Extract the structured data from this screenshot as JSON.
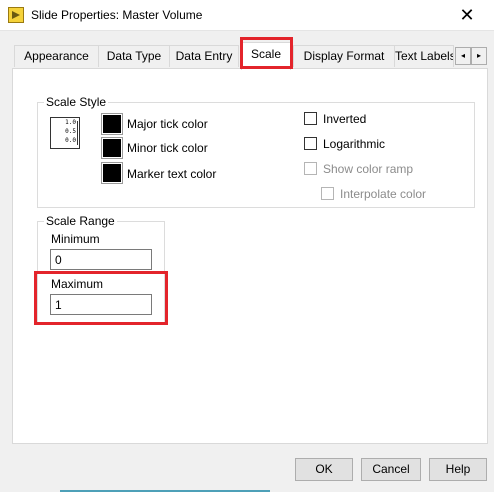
{
  "window": {
    "title": "Slide Properties: Master Volume",
    "close_glyph": "✕"
  },
  "tabs": [
    {
      "label": "Appearance",
      "active": false
    },
    {
      "label": "Data Type",
      "active": false
    },
    {
      "label": "Data Entry",
      "active": false
    },
    {
      "label": "Scale",
      "active": true
    },
    {
      "label": "Display Format",
      "active": false
    },
    {
      "label": "Text Labels",
      "active": false
    }
  ],
  "tab_scroll": {
    "left_glyph": "◂",
    "right_glyph": "▸"
  },
  "scale_style": {
    "group_title": "Scale Style",
    "preview_ticks": [
      "1.0",
      "0.5",
      "0.0"
    ],
    "colors": [
      {
        "label": "Major tick color",
        "swatch": "#000000"
      },
      {
        "label": "Minor tick color",
        "swatch": "#000000"
      },
      {
        "label": "Marker text color",
        "swatch": "#000000"
      }
    ],
    "options": [
      {
        "label": "Inverted",
        "checked": false,
        "enabled": true
      },
      {
        "label": "Logarithmic",
        "checked": false,
        "enabled": true
      },
      {
        "label": "Show color ramp",
        "checked": false,
        "enabled": false
      },
      {
        "label": "Interpolate color",
        "checked": false,
        "enabled": false
      }
    ]
  },
  "scale_range": {
    "group_title": "Scale Range",
    "minimum_label": "Minimum",
    "minimum_value": "0",
    "maximum_label": "Maximum",
    "maximum_value": "1"
  },
  "buttons": {
    "ok": "OK",
    "cancel": "Cancel",
    "help": "Help"
  },
  "colors": {
    "highlight": "#e3242b",
    "panel_bg": "#ffffff",
    "dialog_bg": "#f0f0f0"
  }
}
